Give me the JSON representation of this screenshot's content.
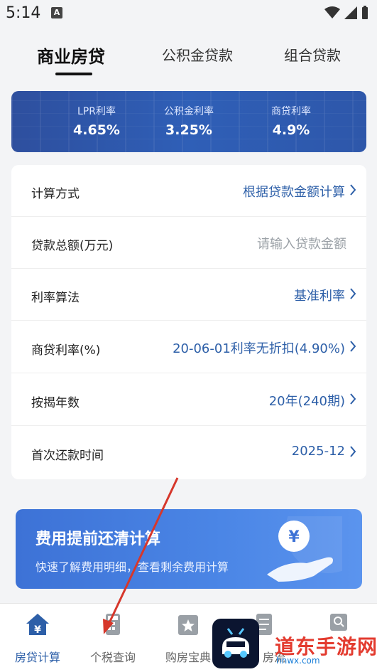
{
  "status": {
    "time": "5:14",
    "notification_badge": "A"
  },
  "tabs": [
    {
      "label": "商业房贷",
      "active": true
    },
    {
      "label": "公积金贷款",
      "active": false
    },
    {
      "label": "组合贷款",
      "active": false
    }
  ],
  "rates": [
    {
      "label": "LPR利率",
      "value": "4.65%"
    },
    {
      "label": "公积金利率",
      "value": "3.25%"
    },
    {
      "label": "商贷利率",
      "value": "4.9%"
    }
  ],
  "form": {
    "calc_method": {
      "label": "计算方式",
      "value": "根据贷款金额计算"
    },
    "loan_amount": {
      "label": "贷款总额(万元)",
      "placeholder": "请输入贷款金额"
    },
    "rate_method": {
      "label": "利率算法",
      "value": "基准利率"
    },
    "commercial_rate": {
      "label": "商贷利率(%)",
      "value": "20-06-01利率无折扣(4.90%)"
    },
    "years": {
      "label": "按揭年数",
      "value": "20年(240期)"
    },
    "first_payment": {
      "label": "首次还款时间",
      "value": "2025-12"
    }
  },
  "promo": {
    "title": "费用提前还清计算",
    "subtitle": "快速了解费用明细，查看剩余费用计算",
    "currency_symbol": "¥"
  },
  "bottom_nav": [
    {
      "label": "房贷计算",
      "icon": "house-yen-icon",
      "active": true
    },
    {
      "label": "个税查询",
      "icon": "calculator-icon",
      "active": false
    },
    {
      "label": "购房宝典",
      "icon": "book-star-icon",
      "active": false
    },
    {
      "label": "房流",
      "icon": "list-icon",
      "active": false
    },
    {
      "label": "",
      "icon": "search-doc-icon",
      "active": false
    }
  ],
  "watermark": {
    "text": "道东手游网",
    "url": "hnwx.com"
  },
  "colors": {
    "accent": "#2d5fa8",
    "rate_card": "#2f5fb7",
    "promo": "#4b86e6",
    "annotation_arrow": "#d6372b"
  }
}
